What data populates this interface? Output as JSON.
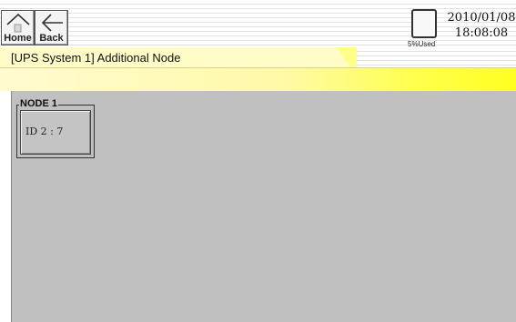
{
  "topbar": {
    "home_label": "Home",
    "back_label": "Back",
    "storage_used": "5%Used",
    "date": "2010/01/08",
    "time": "18:08:08"
  },
  "titlebar": {
    "title": "[UPS System 1] Additional Node"
  },
  "nodes": [
    {
      "legend": "NODE 1",
      "id_text": "ID 2 : 7"
    }
  ],
  "colors": {
    "title_bg": "#ffff88",
    "content_bg": "#c0c0c0"
  },
  "icons": {
    "home": "home-icon",
    "back": "back-arrow-icon",
    "storage": "storage-icon"
  }
}
